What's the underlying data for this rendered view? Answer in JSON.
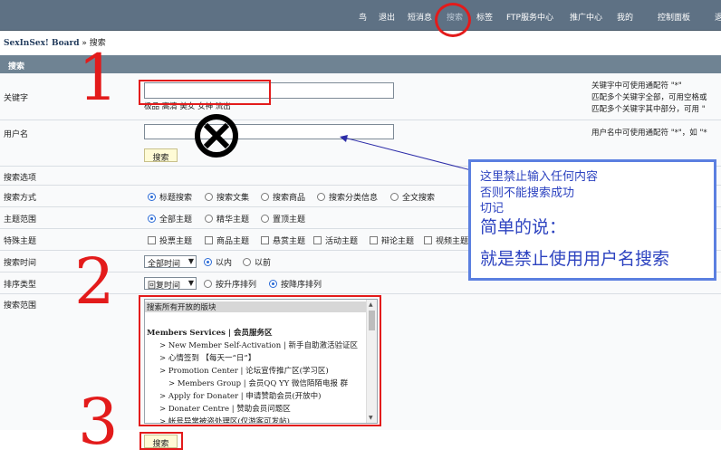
{
  "nav": {
    "links": [
      {
        "label": "鸟",
        "x": 0
      },
      {
        "label": "退出",
        "x": 0
      },
      {
        "label": "短消息",
        "x": 0
      },
      {
        "label": "搜索",
        "x": 0
      },
      {
        "label": "标签",
        "x": 0
      },
      {
        "label": "FTP服务中心",
        "x": 0
      },
      {
        "label": "推广中心",
        "x": 0
      },
      {
        "label": "我的",
        "x": 0
      },
      {
        "label": "控制面板",
        "x": 0
      },
      {
        "label": "退",
        "x": 0
      }
    ]
  },
  "breadcrumb": {
    "board": "SexInSex! Board",
    "separator": "»",
    "current": "搜索"
  },
  "section_title": "搜索",
  "keyword": {
    "label": "关键字",
    "value": "",
    "tags": "极品  高清  美女  女神  流出",
    "hints": [
      "关键字中可使用通配符 \"*\"",
      "匹配多个关键字全部，可用空格或",
      "匹配多个关键字其中部分，可用 \""
    ]
  },
  "username": {
    "label": "用户名",
    "value": "",
    "hint": "用户名中可使用通配符 \"*\"，如 \"*"
  },
  "search_button": "搜索",
  "search_options_label": "搜索选项",
  "search_mode": {
    "label": "搜索方式",
    "options": [
      {
        "label": "标题搜索",
        "checked": true
      },
      {
        "label": "搜索文集",
        "checked": false
      },
      {
        "label": "搜索商品",
        "checked": false
      },
      {
        "label": "搜索分类信息",
        "checked": false
      },
      {
        "label": "全文搜索",
        "checked": false
      }
    ]
  },
  "topic_scope": {
    "label": "主题范围",
    "options": [
      {
        "label": "全部主题",
        "checked": true
      },
      {
        "label": "精华主题",
        "checked": false
      },
      {
        "label": "置顶主题",
        "checked": false
      }
    ]
  },
  "special_topics": {
    "label": "特殊主题",
    "options": [
      "投票主题",
      "商品主题",
      "悬赏主题",
      "活动主题",
      "辩论主题",
      "视频主题"
    ]
  },
  "search_time": {
    "label": "搜索时间",
    "selected": "全部时间",
    "options": [
      {
        "label": "以内",
        "checked": true
      },
      {
        "label": "以前",
        "checked": false
      }
    ]
  },
  "sort_type": {
    "label": "排序类型",
    "selected": "回复时间",
    "options": [
      {
        "label": "按升序排列",
        "checked": false
      },
      {
        "label": "按降序排列",
        "checked": true
      }
    ]
  },
  "search_scope": {
    "label": "搜索范围",
    "items": [
      {
        "text": "搜索所有开放的版块",
        "kind": "sel"
      },
      {
        "text": "",
        "kind": "blank"
      },
      {
        "text": "Members Services | 会员服务区",
        "kind": "grp"
      },
      {
        "text": "> New Member Self-Activation | 新手自助激活验证区",
        "kind": "l1"
      },
      {
        "text": "> 心情签到 【每天一“日”】",
        "kind": "l1"
      },
      {
        "text": "> Promotion Center | 论坛宣传推广区(学习区)",
        "kind": "l1"
      },
      {
        "text": "> Members Group | 会员QQ YY 微信陌陌电报 群",
        "kind": "l2"
      },
      {
        "text": "> Apply for Donater | 申请赞助会员(开放中)",
        "kind": "l1"
      },
      {
        "text": "> Donater Centre | 赞助会员问题区",
        "kind": "l1"
      },
      {
        "text": "> 帐号异常被盗处理区(仅游客可发帖)",
        "kind": "l1"
      }
    ]
  },
  "annotations": {
    "numbers": [
      "1",
      "2",
      "3"
    ],
    "note_lines": [
      "这里禁止输入任何内容",
      "否则不能搜索成功",
      "切记",
      "简单的说：",
      "就是禁止使用用户名搜索"
    ]
  },
  "colors": {
    "nav_bg": "#5e7184",
    "section_bg": "#6f8393",
    "annotation_red": "#e31b1b",
    "annotation_blue": "#2d43c0",
    "button_bg": "#fffbd6"
  }
}
